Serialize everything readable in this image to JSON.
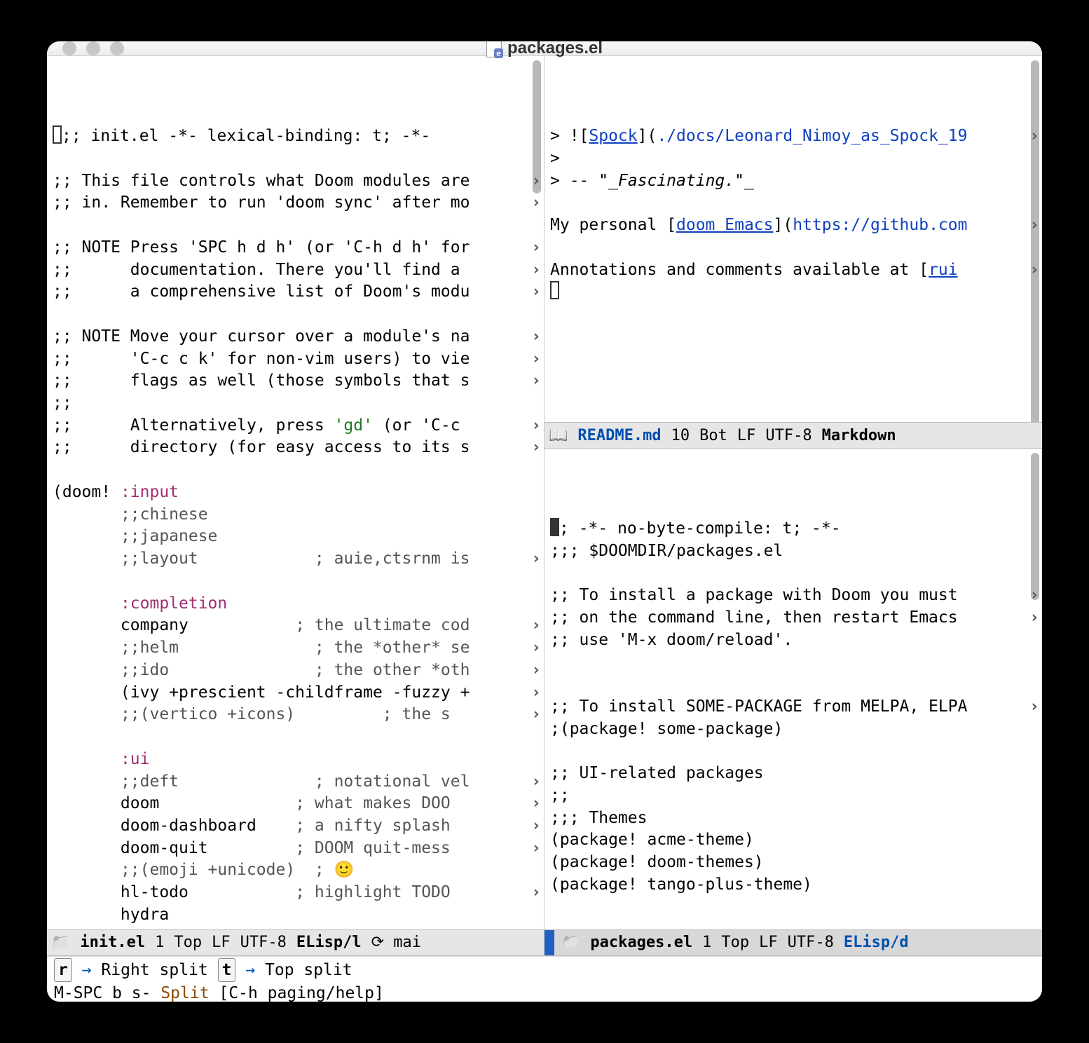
{
  "titlebar": {
    "title": "packages.el"
  },
  "left": {
    "lines": [
      {
        "html": "<span class='cursor'></span>;; init.el -*- lexical-binding: t; -*-"
      },
      {
        "html": ""
      },
      {
        "html": ";; This file controls what Doom modules are",
        "trunc": true
      },
      {
        "html": ";; in. Remember to run 'doom sync' after mo",
        "trunc": true
      },
      {
        "html": ""
      },
      {
        "html": ";; NOTE Press 'SPC h d h' (or 'C-h d h' for",
        "trunc": true
      },
      {
        "html": ";;      documentation. There you'll find a ",
        "trunc": true
      },
      {
        "html": ";;      a comprehensive list of Doom's modu",
        "trunc": true
      },
      {
        "html": ""
      },
      {
        "html": ";; NOTE Move your cursor over a module's na",
        "trunc": true
      },
      {
        "html": ";;      'C-c c k' for non-vim users) to vie",
        "trunc": true
      },
      {
        "html": ";;      flags as well (those symbols that s",
        "trunc": true
      },
      {
        "html": ";;"
      },
      {
        "html": ";;      Alternatively, press <span class='str'>'gd'</span> (or 'C-c ",
        "trunc": true
      },
      {
        "html": ";;      directory (for easy access to its s",
        "trunc": true
      },
      {
        "html": ""
      },
      {
        "html": "(doom! <span class='kw'>:input</span>"
      },
      {
        "html": "       <span class='comment'>;;chinese</span>"
      },
      {
        "html": "       <span class='comment'>;;japanese</span>"
      },
      {
        "html": "       <span class='comment'>;;layout            ; auie,ctsrnm is</span>",
        "trunc": true
      },
      {
        "html": ""
      },
      {
        "html": "       <span class='kw'>:completion</span>"
      },
      {
        "html": "       company           <span class='comment'>; the ultimate cod</span>",
        "trunc": true
      },
      {
        "html": "       <span class='comment'>;;helm              ; the *other* se</span>",
        "trunc": true
      },
      {
        "html": "       <span class='comment'>;;ido               ; the other *oth</span>",
        "trunc": true
      },
      {
        "html": "       (ivy +prescient -childframe -fuzzy +",
        "trunc": true
      },
      {
        "html": "       <span class='comment'>;;(vertico +icons)         ; the s</span>",
        "trunc": true
      },
      {
        "html": ""
      },
      {
        "html": "       <span class='kw'>:ui</span>"
      },
      {
        "html": "       <span class='comment'>;;deft              ; notational vel</span>",
        "trunc": true
      },
      {
        "html": "       doom              <span class='comment'>; what makes DOO</span>",
        "trunc": true
      },
      {
        "html": "       doom-dashboard    <span class='comment'>; a nifty splash</span>",
        "trunc": true
      },
      {
        "html": "       doom-quit         <span class='comment'>; DOOM quit-mess</span>",
        "trunc": true
      },
      {
        "html": "       <span class='comment'>;;(emoji +unicode)  ; 🙂</span>"
      },
      {
        "html": "       hl-todo           <span class='comment'>; highlight TODO</span>",
        "trunc": true
      },
      {
        "html": "       hydra"
      }
    ],
    "modeline": {
      "file": "init.el",
      "pos": "1",
      "scroll": "Top",
      "eol": "LF",
      "enc": "UTF-8",
      "mode": "ELisp/l",
      "vcs": "mai"
    }
  },
  "right_top": {
    "lines": [
      {
        "html": "> ![<span class='link'>Spock</span>](<span class='url'>./docs/Leonard_Nimoy_as_Spock_19</span>",
        "trunc": true
      },
      {
        "html": ">"
      },
      {
        "html": "> -- \"<span class='ital'>_Fascinating.</span>\"_"
      },
      {
        "html": ""
      },
      {
        "html": "My personal [<span class='link'>doom Emacs</span>](<span class='url'>https://github.com</span>",
        "trunc": true
      },
      {
        "html": ""
      },
      {
        "html": "Annotations and comments available at [<span class='link'>rui</span>",
        "trunc": true
      },
      {
        "html": "<span class='cursor'></span>"
      }
    ],
    "modeline": {
      "file": "README.md",
      "pos": "10",
      "scroll": "Bot",
      "eol": "LF",
      "enc": "UTF-8",
      "mode": "Markdown"
    }
  },
  "right_bot": {
    "lines": [
      {
        "html": "<span class='cursor-solid'></span>; -*- no-byte-compile: t; -*-"
      },
      {
        "html": ";;; $DOOMDIR/packages.el"
      },
      {
        "html": ""
      },
      {
        "html": ";; To install a package with Doom you must ",
        "trunc": true
      },
      {
        "html": ";; on the command line, then restart Emacs ",
        "trunc": true
      },
      {
        "html": ";; use 'M-x doom/reload'."
      },
      {
        "html": ""
      },
      {
        "html": ""
      },
      {
        "html": ";; To install SOME-PACKAGE from MELPA, ELPA",
        "trunc": true
      },
      {
        "html": ";(package! some-package)"
      },
      {
        "html": ""
      },
      {
        "html": ";; UI-related packages"
      },
      {
        "html": ";;"
      },
      {
        "html": ";;; Themes"
      },
      {
        "html": "(package! acme-theme)"
      },
      {
        "html": "(package! doom-themes)"
      },
      {
        "html": "(package! tango-plus-theme)"
      }
    ],
    "modeline": {
      "file": "packages.el",
      "pos": "1",
      "scroll": "Top",
      "eol": "LF",
      "enc": "UTF-8",
      "mode": "ELisp/d"
    }
  },
  "minibuffer": {
    "line1_key1": "r",
    "line1_lbl1": "Right split",
    "line1_key2": "t",
    "line1_lbl2": "Top split",
    "line2_pre": "M-SPC b s- ",
    "line2_title": "Split",
    "line2_help": " [C-h paging/help]"
  }
}
